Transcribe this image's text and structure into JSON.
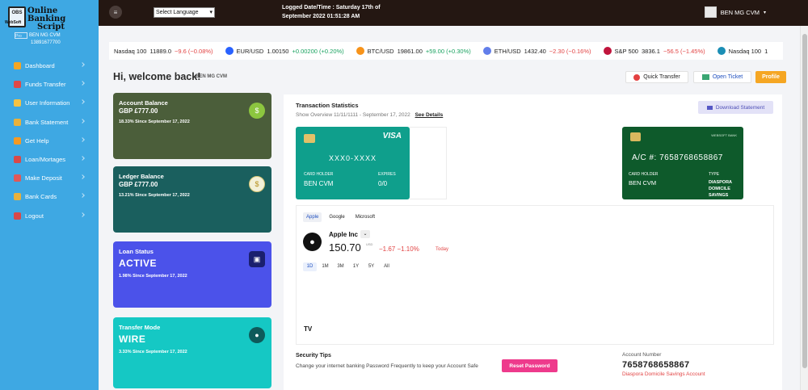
{
  "logo": {
    "line1": "Online Banking",
    "line2": "Script",
    "sub": "WebSoft"
  },
  "sidebar_user": {
    "img_alt": "Pro",
    "name": "BEN MG CVM",
    "id": "13891677700"
  },
  "sidebar": {
    "items": [
      {
        "label": "Dashboard",
        "icon": "home-icon"
      },
      {
        "label": "Funds Transfer",
        "icon": "transfer-icon"
      },
      {
        "label": "User Information",
        "icon": "user-icon"
      },
      {
        "label": "Bank Statement",
        "icon": "statement-icon"
      },
      {
        "label": "Get Help",
        "icon": "help-icon"
      },
      {
        "label": "Loan/Mortages",
        "icon": "loan-icon"
      },
      {
        "label": "Make Deposit",
        "icon": "deposit-icon"
      },
      {
        "label": "Bank Cards",
        "icon": "card-icon"
      },
      {
        "label": "Logout",
        "icon": "logout-icon"
      }
    ]
  },
  "topbar": {
    "language": "Select Language",
    "logged_line1": "Logged Date/Time : Saturday 17th of",
    "logged_line2": "September 2022 01:51:28 AM",
    "user": "BEN MG CVM"
  },
  "ticker": [
    {
      "name": "Nasdaq 100",
      "price": "11889.0",
      "change": "−9.6 (−0.08%)",
      "dir": "neg",
      "color": ""
    },
    {
      "name": "EUR/USD",
      "price": "1.00150",
      "change": "+0.00200 (+0.20%)",
      "dir": "pos",
      "color": "#2962ff"
    },
    {
      "name": "BTC/USD",
      "price": "19861.00",
      "change": "+59.00 (+0.30%)",
      "dir": "pos",
      "color": "#f7931a"
    },
    {
      "name": "ETH/USD",
      "price": "1432.40",
      "change": "−2.30 (−0.16%)",
      "dir": "neg",
      "color": "#627eea"
    },
    {
      "name": "S&P 500",
      "price": "3836.1",
      "change": "−56.5 (−1.45%)",
      "dir": "neg",
      "color": "#c0143c"
    },
    {
      "name": "Nasdaq 100",
      "price": "1",
      "change": "",
      "dir": "neg",
      "color": "#1b8eb5"
    }
  ],
  "welcome": {
    "greeting": "Hi, welcome back!",
    "name": "BEN MG CVM"
  },
  "actions": {
    "quick_transfer": "Quick Transfer",
    "open_ticket": "Open Ticket",
    "profile": "Profile"
  },
  "stats": [
    {
      "title": "Account Balance",
      "value": "GBP £777.00",
      "since": "18.33% Since September 17, 2022"
    },
    {
      "title": "Ledger Balance",
      "value": "GBP £777.00",
      "since": "13.21% Since September 17, 2022"
    },
    {
      "title": "Loan Status",
      "value": "ACTIVE",
      "since": "1.98% Since September 17, 2022"
    },
    {
      "title": "Transfer Mode",
      "value": "WIRE",
      "since": "3.33% Since September 17, 2022"
    }
  ],
  "transactions": {
    "title": "Transaction Statistics",
    "subtitle": "Show Overview 11/11/1111 - September 17, 2022",
    "see_details": "See Details",
    "download": "Download Statement"
  },
  "visa_card": {
    "brand": "VISA",
    "number": "XXX0-XXXX",
    "holder_label": "CARD HOLDER",
    "holder": "BEN CVM",
    "expires_label": "EXPIRES",
    "expires": "0/0"
  },
  "bank_card": {
    "bank_name": "WEBSOFT BANK",
    "account": "A/C #: 7658768658867",
    "holder_label": "CARD HOLDER",
    "holder": "BEN CVM",
    "type_label": "TYPE",
    "type_line1": "DIASPORA",
    "type_line2": "DOMICILE",
    "type_line3": "SAVINGS"
  },
  "widget": {
    "tabs": [
      "Apple",
      "Google",
      "Microsoft"
    ],
    "company": "Apple Inc",
    "price": "150.70",
    "currency_line1": "USD",
    "currency_line2": "",
    "change": "−1.67  −1.10%",
    "period": "Today",
    "ranges": [
      "1D",
      "1M",
      "3M",
      "1Y",
      "5Y",
      "All"
    ],
    "tv_logo": "TV"
  },
  "security": {
    "title": "Security Tips",
    "text": "Change your internet banking Password Frequently to keep your Account Safe",
    "reset": "Reset Password"
  },
  "account_number": {
    "label": "Account Number",
    "value": "7658768658867",
    "type": "Diaspora Domicile Savings Account"
  }
}
